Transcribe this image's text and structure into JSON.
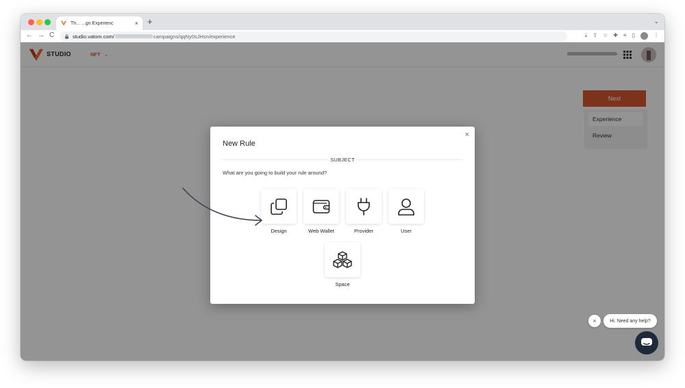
{
  "browser": {
    "tab_title": "Th... ...gn Experienc",
    "tab_close": "×",
    "new_tab": "+",
    "tab_menu": "⌄",
    "nav_back": "←",
    "nav_forward": "→",
    "nav_reload": "C",
    "url_host": "studio.vatom.com/",
    "url_path": "campaigns/qqNy0sJHsn/experience"
  },
  "app": {
    "brand": "STUDIO",
    "menu_label": "NFT",
    "menu_chevron": "⌄",
    "account_chevron": "⌄",
    "account_more": "..",
    "accent_color": "#d6562f"
  },
  "sidebar": {
    "next_label": "Next",
    "steps": [
      {
        "label": "Experience"
      },
      {
        "label": "Review"
      }
    ]
  },
  "modal": {
    "title": "New Rule",
    "close": "×",
    "section_label": "SUBJECT",
    "question": "What are you going to build your rule around?",
    "options": [
      {
        "label": "Design",
        "icon": "copy-icon"
      },
      {
        "label": "Web Wallet",
        "icon": "wallet-icon"
      },
      {
        "label": "Provider",
        "icon": "plug-icon"
      },
      {
        "label": "User",
        "icon": "user-icon"
      },
      {
        "label": "Space",
        "icon": "cubes-icon"
      }
    ]
  },
  "chat": {
    "bubble_text": "Hi. Need any help?",
    "close": "×"
  }
}
